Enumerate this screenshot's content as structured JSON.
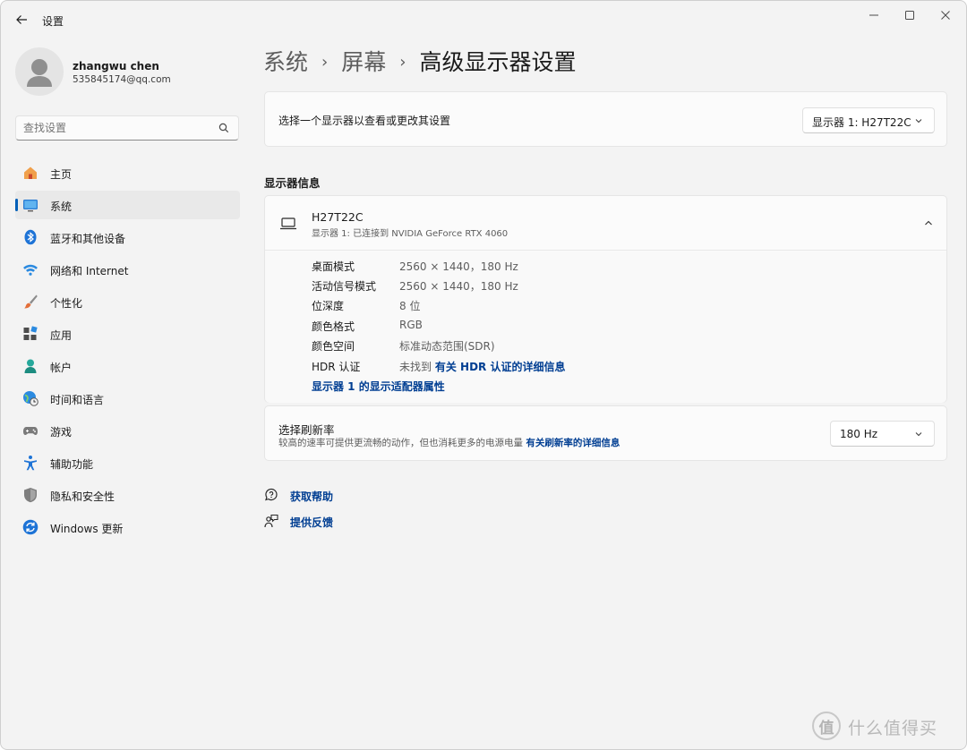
{
  "window": {
    "app_title": "设置",
    "icons": {
      "back": "back-arrow-icon",
      "minimize": "minimize-icon",
      "maximize": "maximize-icon",
      "close": "close-icon"
    }
  },
  "profile": {
    "name": "zhangwu chen",
    "email": "535845174@qq.com"
  },
  "search": {
    "placeholder": "查找设置",
    "icon": "search-icon"
  },
  "sidebar": {
    "accent_color": "#005fb8",
    "items": [
      {
        "label": "主页",
        "icon": "home-icon",
        "active": false
      },
      {
        "label": "系统",
        "icon": "system-display-icon",
        "active": true
      },
      {
        "label": "蓝牙和其他设备",
        "icon": "bluetooth-icon",
        "active": false
      },
      {
        "label": "网络和 Internet",
        "icon": "wifi-icon",
        "active": false
      },
      {
        "label": "个性化",
        "icon": "paintbrush-icon",
        "active": false
      },
      {
        "label": "应用",
        "icon": "apps-icon",
        "active": false
      },
      {
        "label": "帐户",
        "icon": "account-icon",
        "active": false
      },
      {
        "label": "时间和语言",
        "icon": "globe-clock-icon",
        "active": false
      },
      {
        "label": "游戏",
        "icon": "gamepad-icon",
        "active": false
      },
      {
        "label": "辅助功能",
        "icon": "accessibility-icon",
        "active": false
      },
      {
        "label": "隐私和安全性",
        "icon": "shield-icon",
        "active": false
      },
      {
        "label": "Windows 更新",
        "icon": "windows-update-icon",
        "active": false
      }
    ]
  },
  "breadcrumb": [
    "系统",
    "屏幕",
    "高级显示器设置"
  ],
  "display_select": {
    "label": "选择一个显示器以查看或更改其设置",
    "selected": "显示器 1: H27T22C"
  },
  "display_info": {
    "section_title": "显示器信息",
    "monitor_name": "H27T22C",
    "monitor_subtitle": "显示器 1: 已连接到 NVIDIA GeForce RTX 4060",
    "rows": [
      {
        "key": "桌面模式",
        "value": "2560 × 1440，180 Hz"
      },
      {
        "key": "活动信号模式",
        "value": "2560 × 1440，180 Hz"
      },
      {
        "key": "位深度",
        "value": "8 位"
      },
      {
        "key": "颜色格式",
        "value": "RGB"
      },
      {
        "key": "颜色空间",
        "value": "标准动态范围(SDR)"
      }
    ],
    "hdr": {
      "key": "HDR 认证",
      "value": "未找到",
      "link": "有关 HDR 认证的详细信息"
    },
    "adapter_link": "显示器 1 的显示适配器属性"
  },
  "refresh_rate": {
    "title": "选择刷新率",
    "description": "较高的速率可提供更流畅的动作，但也消耗更多的电源电量",
    "link": "有关刷新率的详细信息",
    "selected": "180 Hz"
  },
  "help_links": [
    {
      "label": "获取帮助",
      "icon": "help-icon"
    },
    {
      "label": "提供反馈",
      "icon": "feedback-icon"
    }
  ],
  "watermark": {
    "text": "什么值得买",
    "badge": "值"
  }
}
